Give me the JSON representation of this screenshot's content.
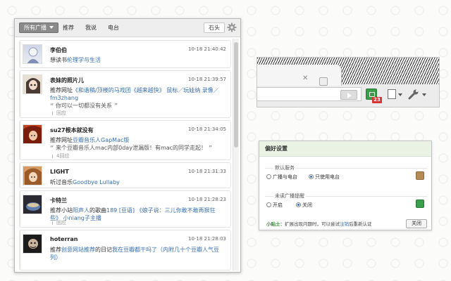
{
  "popup": {
    "tabs": {
      "active": "所有广播",
      "recommend": "推荐",
      "mine": "我说",
      "radio": "电台"
    },
    "search_label": "石头",
    "items": [
      {
        "user": "李伯伯",
        "time": "10-18 21:40:42",
        "text": "想读书",
        "link": "伦理学与生活"
      },
      {
        "user": "表妹的照片儿",
        "time": "10-18 21:39:57",
        "text": "推荐网址",
        "link": "《和谐稿/顶楼的马戏团《越来越快》 鼠标／玩娃纳 录像／fm3zhang",
        "quote": "你可以一切都没有关系",
        "reply": "回应"
      },
      {
        "user": "su27根本就没有",
        "time": "10-18 21:34:05",
        "text": "推荐网址",
        "link": "豆瓣音乐人GapMac版",
        "quote": "来个豆瓣音乐人mac内部0day泄漏版！有mac的同学走起！",
        "reply": "4回应"
      },
      {
        "user": "LIGHT",
        "time": "10-18 21:31:33",
        "text": "听过音乐",
        "link": "Goodbye Lullaby"
      },
      {
        "user": "卡特兰",
        "time": "10-18 21:28:23",
        "text": "推荐小站",
        "link_parts": [
          "阳声人",
          "189 [豆语]",
          "《娘子说：三儿你敢不敢再狠狂些》 小niang子主播"
        ],
        "mid1": "的歌曲",
        "mid2": "",
        "reply": "回应"
      },
      {
        "user": "hoterran",
        "time": "10-18 21:28:03",
        "text": "推荐",
        "link": "创意网站推荐",
        "mid": "的日记",
        "link2": "我在豆瓣都干吗了（内附几十个豆瓣人气豆列）"
      }
    ]
  },
  "browser": {
    "badge_count": "23"
  },
  "prefs": {
    "title": "偏好设置",
    "group1": {
      "title": "默认服务",
      "opt1": "广播与电台",
      "opt2": "只使用电台",
      "selected": "只使用电台"
    },
    "group2": {
      "title": "未读广播提醒",
      "opt1": "开启",
      "opt2": "关闭",
      "selected": "关闭"
    },
    "tip_label": "小贴士：",
    "tip_text": "扩展出现问题时，可以尝试",
    "tip_link": "注销",
    "tip_tail": "后重新认证",
    "close_label": "关闭"
  },
  "colors": {
    "link": "#3a6fb0",
    "badge": "#d63333",
    "ext_green": "#3a9e4a",
    "prefs_header": "#eaf2e4"
  }
}
